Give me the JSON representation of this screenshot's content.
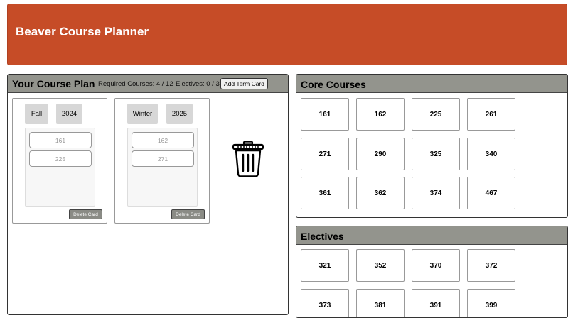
{
  "app": {
    "title": "Beaver Course Planner"
  },
  "plan": {
    "title": "Your Course Plan",
    "required": "Required Courses: 4 / 12",
    "electives": "Electives: 0 / 3",
    "add_term_label": "Add Term Card",
    "terms": [
      {
        "season": "Fall",
        "year": "2024",
        "courses": [
          "161",
          "225"
        ],
        "delete_label": "Delete Card"
      },
      {
        "season": "Winter",
        "year": "2025",
        "courses": [
          "162",
          "271"
        ],
        "delete_label": "Delete Card"
      }
    ],
    "trash_icon": "trash-can-icon"
  },
  "core": {
    "title": "Core Courses",
    "courses": [
      "161",
      "162",
      "225",
      "261",
      "271",
      "290",
      "325",
      "340",
      "361",
      "362",
      "374",
      "467"
    ]
  },
  "electives": {
    "title": "Electives",
    "courses": [
      "321",
      "352",
      "370",
      "372",
      "373",
      "381",
      "391",
      "399"
    ]
  },
  "colors": {
    "header": "#c64c27",
    "section_header": "#93948d"
  }
}
